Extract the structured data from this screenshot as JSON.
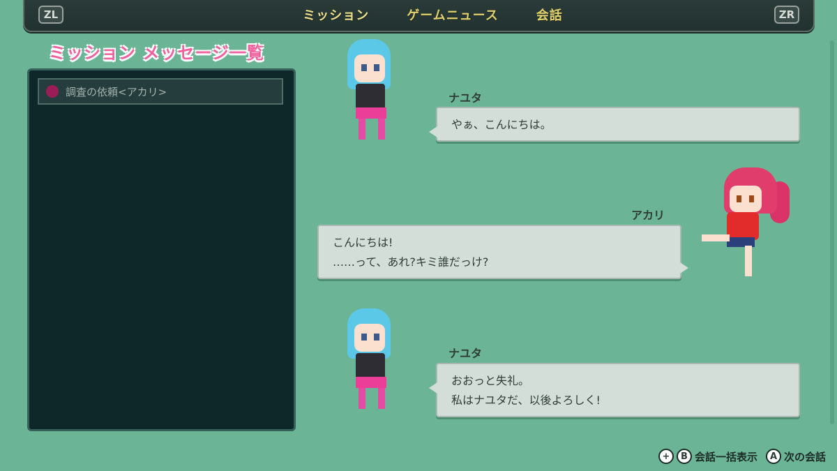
{
  "header": {
    "left_trigger": "ZL",
    "right_trigger": "ZR",
    "tabs": [
      {
        "label": "ミッション",
        "active": true
      },
      {
        "label": "ゲームニュース",
        "active": false
      },
      {
        "label": "会話",
        "active": false
      }
    ]
  },
  "sidebar": {
    "title": "ミッション メッセージ一覧",
    "items": [
      {
        "label": "調査の依頼<アカリ>",
        "status_color": "#9b1d57"
      }
    ]
  },
  "conversation": {
    "messages": [
      {
        "speaker": "ナユタ",
        "side": "left",
        "lines": [
          "やぁ、こんにちは。"
        ]
      },
      {
        "speaker": "アカリ",
        "side": "right",
        "lines": [
          "こんにちは!",
          "……って、あれ?キミ誰だっけ?"
        ]
      },
      {
        "speaker": "ナユタ",
        "side": "left",
        "lines": [
          "おおっと失礼。",
          "私はナユタだ、以後よろしく!"
        ]
      }
    ]
  },
  "footer": {
    "plus_glyph": "+",
    "b_glyph": "B",
    "show_all_label": "会話一括表示",
    "a_glyph": "A",
    "next_label": "次の会話"
  },
  "colors": {
    "background": "#6bb596",
    "title_pink": "#f0609c",
    "tab_yellow": "#e3d16c",
    "panel_dark": "#0e2729",
    "bubble": "#d3ded9"
  }
}
